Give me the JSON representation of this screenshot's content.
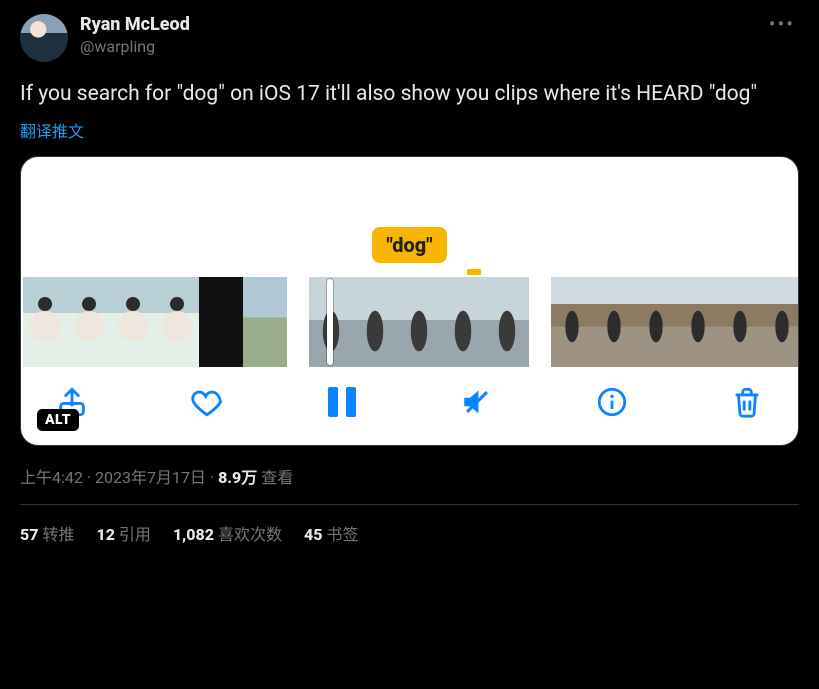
{
  "author": {
    "display_name": "Ryan McLeod",
    "handle": "@warpling"
  },
  "more_glyph": "•••",
  "body_text": "If you search for \"dog\" on iOS 17 it'll also show you clips where it's HEARD \"dog\"",
  "translate_label": "翻译推文",
  "media": {
    "search_tag": "\"dog\"",
    "alt_badge": "ALT",
    "toolbar": {
      "share": "share",
      "like": "like",
      "pause": "pause",
      "mute": "mute",
      "info": "info",
      "trash": "trash"
    }
  },
  "meta": {
    "time": "上午4:42",
    "date": "2023年7月17日",
    "separator": " · ",
    "views_number": "8.9万",
    "views_label": " 查看"
  },
  "stats": {
    "retweets_count": "57",
    "retweets_label": "转推",
    "quotes_count": "12",
    "quotes_label": "引用",
    "likes_count": "1,082",
    "likes_label": "喜欢次数",
    "bookmarks_count": "45",
    "bookmarks_label": "书签"
  }
}
